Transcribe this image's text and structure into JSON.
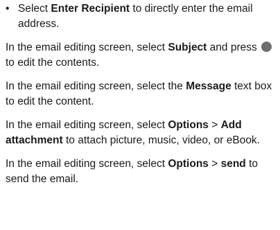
{
  "bullet_item": {
    "marker": "•",
    "text_before": "Select ",
    "bold": "Enter Recipient",
    "text_after": " to directly enter the email address."
  },
  "paragraphs": [
    {
      "before": "In the email editing screen, select ",
      "bold": "Subject",
      "middle": " and press ",
      "icon": "round-button-icon",
      "after": " to edit the contents."
    },
    {
      "before": "In the email editing screen, select the ",
      "bold": "Message",
      "after": " text box to edit the content."
    },
    {
      "before": "In the email editing screen, select ",
      "bold": "Options",
      "separator": " > ",
      "bold2": "Add attachment",
      "after": " to attach picture, music, video, or eBook."
    },
    {
      "before": "In the email editing screen, select ",
      "bold": "Options",
      "separator": " > ",
      "bold2": "send",
      "after": " to send the email."
    }
  ],
  "colors": {
    "text": "#1a1a1a",
    "button": "#6f6f6f"
  }
}
